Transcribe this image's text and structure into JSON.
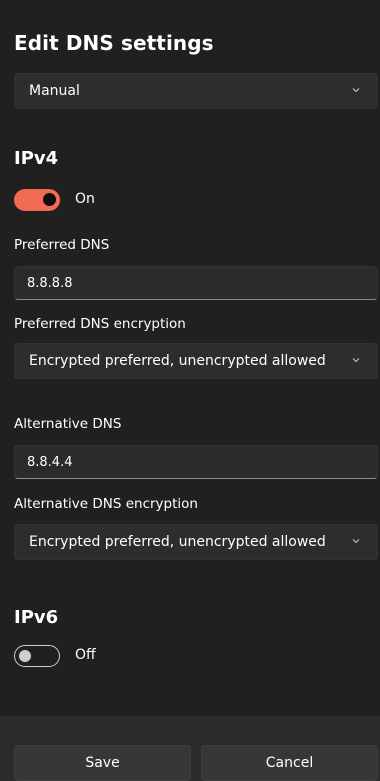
{
  "dialog": {
    "title": "Edit DNS settings",
    "mode_value": "Manual"
  },
  "ipv4": {
    "title": "IPv4",
    "toggle_label": "On",
    "toggle_on": true,
    "preferred_dns_label": "Preferred DNS",
    "preferred_dns_value": "8.8.8.8",
    "preferred_encryption_label": "Preferred DNS encryption",
    "preferred_encryption_value": "Encrypted preferred, unencrypted allowed",
    "alternative_dns_label": "Alternative DNS",
    "alternative_dns_value": "8.8.4.4",
    "alternative_encryption_label": "Alternative DNS encryption",
    "alternative_encryption_value": "Encrypted preferred, unencrypted allowed"
  },
  "ipv6": {
    "title": "IPv6",
    "toggle_label": "Off",
    "toggle_on": false
  },
  "footer": {
    "save_label": "Save",
    "cancel_label": "Cancel"
  },
  "colors": {
    "accent": "#f06b52",
    "background": "#202020",
    "footer_background": "#2b2b2b"
  },
  "icons": {
    "dropdown": "chevron-down-icon"
  }
}
